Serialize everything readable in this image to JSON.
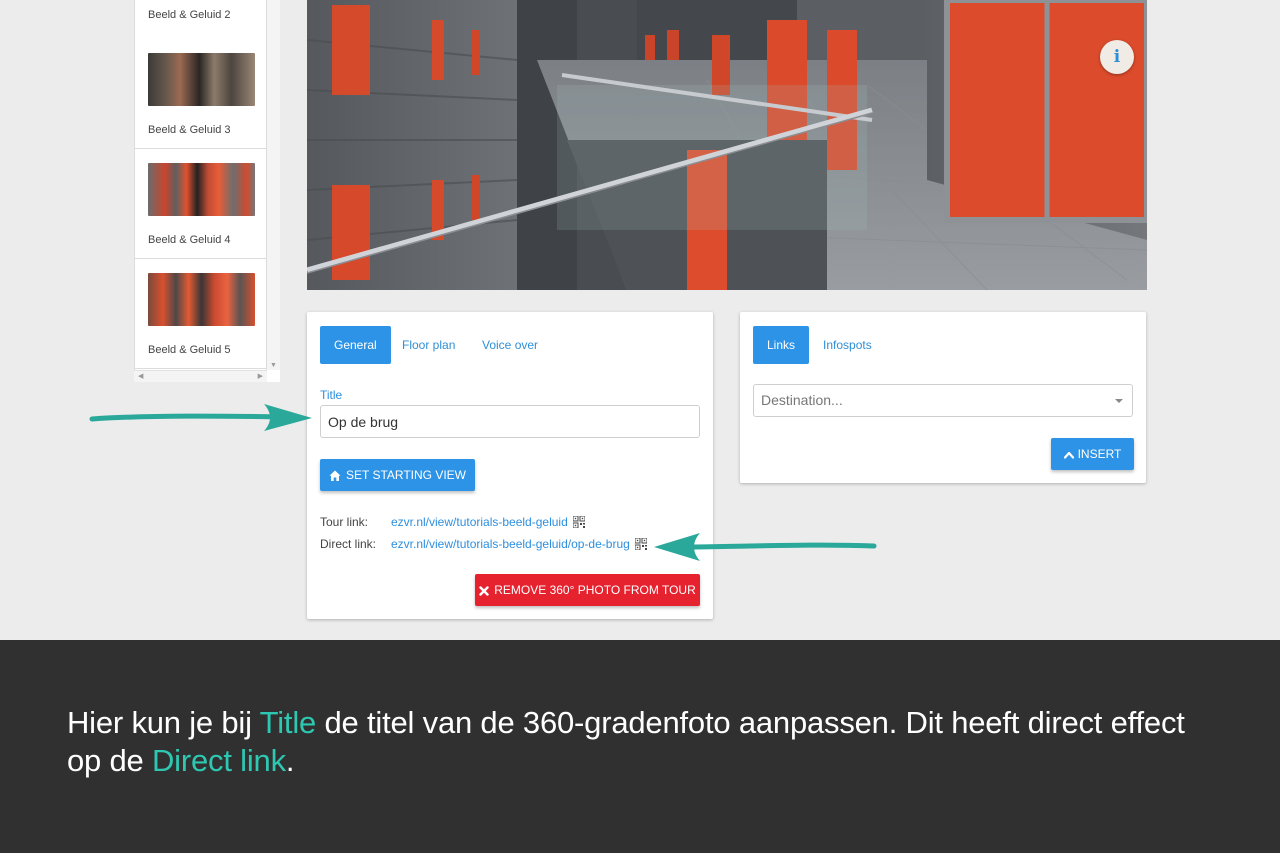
{
  "sidebar": {
    "items": [
      {
        "label": "Beeld & Geluid 2"
      },
      {
        "label": "Beeld & Geluid 3"
      },
      {
        "label": "Beeld & Geluid 4"
      },
      {
        "label": "Beeld & Geluid 5"
      }
    ]
  },
  "panorama": {
    "info_icon_text": "i"
  },
  "general_card": {
    "tabs": [
      {
        "label": "General",
        "active": true
      },
      {
        "label": "Floor plan",
        "active": false
      },
      {
        "label": "Voice over",
        "active": false
      }
    ],
    "title_label": "Title",
    "title_value": "Op de brug",
    "starting_view_button": "SET STARTING VIEW",
    "tour_link_label": "Tour link:",
    "tour_link_url": "ezvr.nl/view/tutorials-beeld-geluid",
    "direct_link_label": "Direct link:",
    "direct_link_url": "ezvr.nl/view/tutorials-beeld-geluid/op-de-brug",
    "remove_button": "REMOVE 360° PHOTO FROM TOUR"
  },
  "links_card": {
    "tabs": [
      {
        "label": "Links",
        "active": true
      },
      {
        "label": "Infospots",
        "active": false
      }
    ],
    "destination_placeholder": "Destination...",
    "insert_button": "INSERT"
  },
  "caption": {
    "part1": "Hier kun je bij ",
    "highlight1": "Title",
    "part2": " de titel van de 360-gradenfoto aanpassen. Dit heeft direct effect op de ",
    "highlight2": "Direct link",
    "part3": "."
  },
  "colors": {
    "primary": "#2d93e6",
    "danger": "#e6222f",
    "accent": "#2ec7b1",
    "caption_bg": "#303030",
    "arrow": "#2aa99a"
  },
  "icons": {
    "home": "home-icon",
    "remove": "close-icon",
    "insert": "chevron-up-icon",
    "qr": "qr-code-icon",
    "info": "info-icon"
  }
}
